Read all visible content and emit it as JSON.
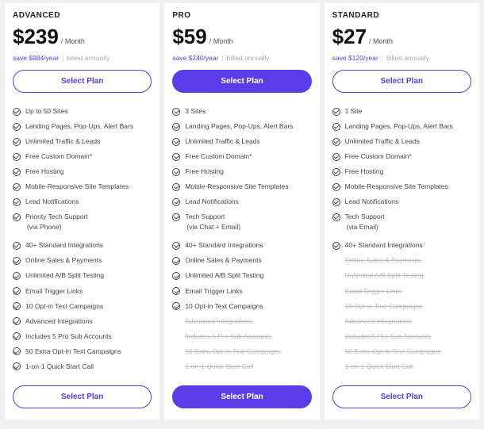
{
  "common": {
    "period": "/ Month",
    "billed": "billed annually",
    "select": "Select Plan"
  },
  "plans": [
    {
      "name": "ADVANCED",
      "price": "$239",
      "savings": "save $984/year",
      "highlight": false,
      "features": [
        {
          "text": "Up to 50 Sites"
        },
        {
          "text": "Landing Pages, Pop-Ups, Alert Bars"
        },
        {
          "text": "Unlimited Traffic & Leads"
        },
        {
          "text": "Free Custom Domain*"
        },
        {
          "text": "Free Hosting"
        },
        {
          "text": "Mobile-Responsive Site Templates"
        },
        {
          "text": "Lead Notifications"
        },
        {
          "text": "Priority Tech Support",
          "sub": "(via Phone)"
        },
        {
          "gap": true
        },
        {
          "text": "40+ Standard Integrations"
        },
        {
          "text": "Online Sales & Payments"
        },
        {
          "text": "Unlimited A/B Split Testing"
        },
        {
          "text": "Email Trigger Links"
        },
        {
          "text": "10 Opt-in Text Campaigns"
        },
        {
          "text": "Advanced Integrations"
        },
        {
          "text": "Includes 5 Pro Sub Accounts"
        },
        {
          "text": "50 Extra Opt-In Text Campaigns"
        },
        {
          "text": "1-on-1 Quick Start Call"
        }
      ]
    },
    {
      "name": "PRO",
      "price": "$59",
      "savings": "save $240/year",
      "highlight": true,
      "features": [
        {
          "text": "3 Sites"
        },
        {
          "text": "Landing Pages, Pop-Ups, Alert Bars"
        },
        {
          "text": "Unlimited Traffic & Leads"
        },
        {
          "text": "Free Custom Domain*"
        },
        {
          "text": "Free Hosting"
        },
        {
          "text": "Mobile-Responsive Site Templates"
        },
        {
          "text": "Lead Notifications"
        },
        {
          "text": "Tech Support",
          "sub": "(via Chat + Email)"
        },
        {
          "gap": true
        },
        {
          "text": "40+ Standard Integrations"
        },
        {
          "text": "Online Sales & Payments"
        },
        {
          "text": "Unlimited A/B Split Testing"
        },
        {
          "text": "Email Trigger Links"
        },
        {
          "text": "10 Opt-in Text Campaigns"
        },
        {
          "text": "Advanced Integrations",
          "disabled": true
        },
        {
          "text": "Includes 5 Pro Sub Accounts",
          "disabled": true
        },
        {
          "text": "50 Extra Opt-In Text Campaigns",
          "disabled": true
        },
        {
          "text": "1-on-1 Quick Start Call",
          "disabled": true
        }
      ]
    },
    {
      "name": "STANDARD",
      "price": "$27",
      "savings": "save $120/year",
      "highlight": false,
      "features": [
        {
          "text": "1 Site"
        },
        {
          "text": "Landing Pages, Pop-Ups, Alert Bars"
        },
        {
          "text": "Unlimited Traffic & Leads"
        },
        {
          "text": "Free Custom Domain*"
        },
        {
          "text": "Free Hosting"
        },
        {
          "text": "Mobile-Responsive Site Templates"
        },
        {
          "text": "Lead Notifications"
        },
        {
          "text": "Tech Support",
          "sub": "(via Email)"
        },
        {
          "gap": true
        },
        {
          "text": "40+ Standard Integrations"
        },
        {
          "text": "Online Sales & Payments",
          "disabled": true
        },
        {
          "text": "Unlimited A/B Split Testing",
          "disabled": true
        },
        {
          "text": "Email Trigger Links",
          "disabled": true
        },
        {
          "text": "10 Opt-in Text Campaigns",
          "disabled": true
        },
        {
          "text": "Advanced Integrations",
          "disabled": true
        },
        {
          "text": "Includes 5 Pro Sub Accounts",
          "disabled": true
        },
        {
          "text": "50 Extra Opt-In Text Campaigns",
          "disabled": true
        },
        {
          "text": "1-on-1 Quick Start Call",
          "disabled": true
        }
      ]
    }
  ]
}
